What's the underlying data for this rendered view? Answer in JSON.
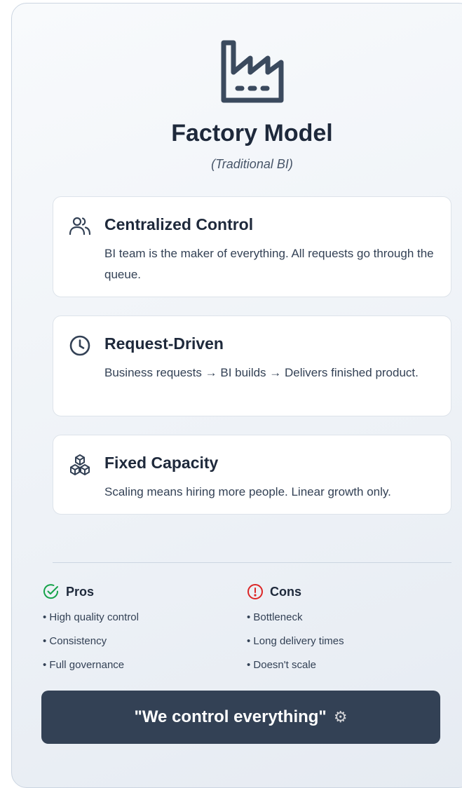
{
  "header": {
    "icon": "factory-icon",
    "title": "Factory Model",
    "subtitle": "(Traditional BI)"
  },
  "cards": [
    {
      "icon": "users-icon",
      "title": "Centralized Control",
      "description": "BI team is the maker of everything. All requests go through the queue."
    },
    {
      "icon": "clock-icon",
      "title": "Request-Driven",
      "description": "Business requests → BI builds → Delivers finished product."
    },
    {
      "icon": "boxes-icon",
      "title": "Fixed Capacity",
      "description": "Scaling means hiring more people. Linear growth only."
    }
  ],
  "pros": {
    "icon": "check-circle-icon",
    "title": "Pros",
    "color": "#16a34a",
    "items": [
      "• High quality control",
      "• Consistency",
      "• Full governance"
    ]
  },
  "cons": {
    "icon": "alert-circle-icon",
    "title": "Cons",
    "color": "#dc2626",
    "items": [
      "• Bottleneck",
      "• Long delivery times",
      "• Doesn't scale"
    ]
  },
  "quote": {
    "text": "\"We control everything\"",
    "icon": "gear-icon",
    "background": "#334155"
  }
}
